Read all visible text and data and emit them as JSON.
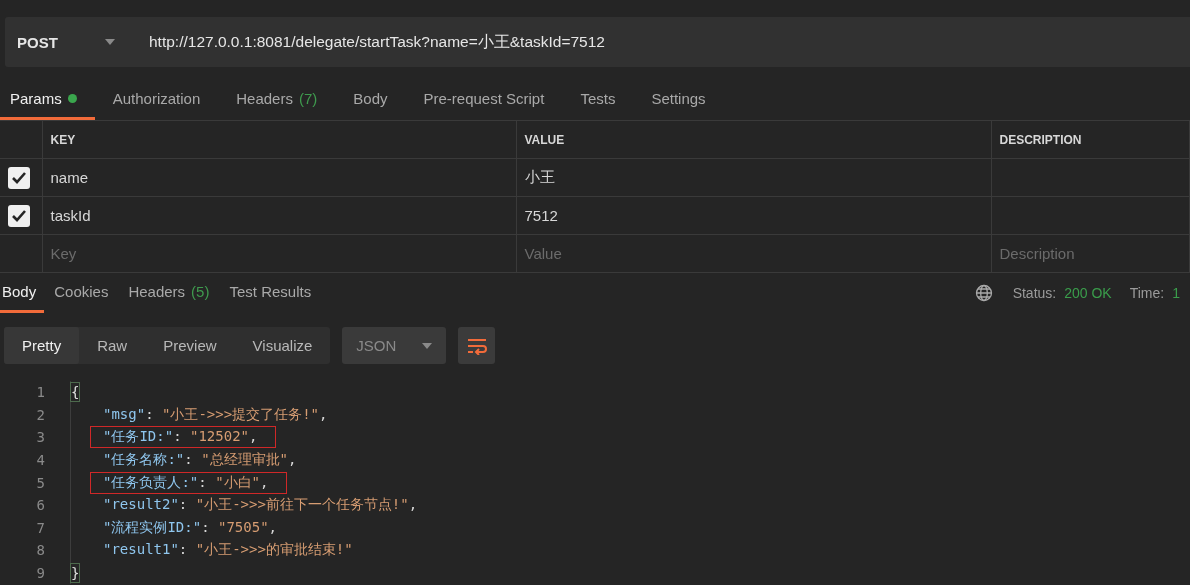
{
  "request": {
    "method": "POST",
    "url": "http://127.0.0.1:8081/delegate/startTask?name=小王&taskId=7512"
  },
  "request_tabs": [
    {
      "label": "Params",
      "selected": true,
      "dot": true
    },
    {
      "label": "Authorization",
      "selected": false
    },
    {
      "label": "Headers",
      "count": "(7)",
      "selected": false
    },
    {
      "label": "Body",
      "selected": false
    },
    {
      "label": "Pre-request Script",
      "selected": false
    },
    {
      "label": "Tests",
      "selected": false
    },
    {
      "label": "Settings",
      "selected": false
    }
  ],
  "params": {
    "columns": [
      "KEY",
      "VALUE",
      "DESCRIPTION"
    ],
    "rows": [
      {
        "checked": true,
        "key": "name",
        "value": "小王"
      },
      {
        "checked": true,
        "key": "taskId",
        "value": "7512"
      }
    ],
    "new_row": {
      "key": {
        "placeholder": "Key"
      },
      "value": {
        "placeholder": "Value"
      },
      "description": {
        "placeholder": "Description"
      }
    }
  },
  "response_tabs": [
    {
      "label": "Body",
      "selected": true
    },
    {
      "label": "Cookies",
      "selected": false
    },
    {
      "label": "Headers",
      "count": "(5)",
      "selected": false
    },
    {
      "label": "Test Results",
      "selected": false
    }
  ],
  "status": {
    "label": "Status:",
    "value": "200 OK",
    "time_label": "Time:",
    "time_value": "1"
  },
  "view_modes": [
    {
      "label": "Pretty",
      "selected": true
    },
    {
      "label": "Raw",
      "selected": false
    },
    {
      "label": "Preview",
      "selected": false
    },
    {
      "label": "Visualize",
      "selected": false
    }
  ],
  "format": "JSON",
  "code_lines": [
    {
      "number": "1",
      "kind": "brace",
      "text": "{"
    },
    {
      "number": "2",
      "kind": "pair",
      "key": "\"msg\"",
      "colon": ": ",
      "value": "\"小王->>>提交了任务!\"",
      "end": ",",
      "boxed": false
    },
    {
      "number": "3",
      "kind": "pair",
      "key": "\"任务ID:\"",
      "colon": ": ",
      "value": "\"12502\"",
      "end": ",",
      "boxed": true
    },
    {
      "number": "4",
      "kind": "pair",
      "key": "\"任务名称:\"",
      "colon": ": ",
      "value": "\"总经理审批\"",
      "end": ",",
      "boxed": false
    },
    {
      "number": "5",
      "kind": "pair",
      "key": "\"任务负责人:\"",
      "colon": ": ",
      "value": "\"小白\"",
      "end": ",",
      "boxed": true
    },
    {
      "number": "6",
      "kind": "pair",
      "key": "\"result2\"",
      "colon": ": ",
      "value": "\"小王->>>前往下一个任务节点!\"",
      "end": ",",
      "boxed": false
    },
    {
      "number": "7",
      "kind": "pair",
      "key": "\"流程实例ID:\"",
      "colon": ": ",
      "value": "\"7505\"",
      "end": ",",
      "boxed": false
    },
    {
      "number": "8",
      "kind": "pair",
      "key": "\"result1\"",
      "colon": ": ",
      "value": "\"小王->>>的审批结束!\"",
      "boxed": false
    },
    {
      "number": "9",
      "kind": "brace",
      "text": "}"
    }
  ]
}
